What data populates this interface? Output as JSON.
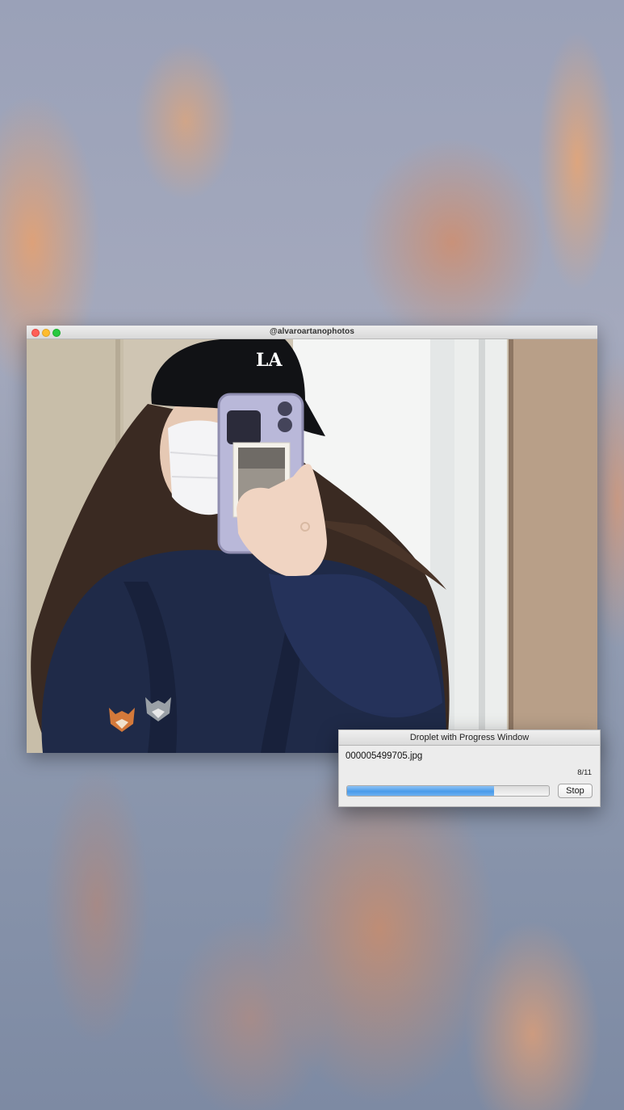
{
  "photo_window": {
    "title": "@alvaroartanophotos",
    "cap_logo": "LA"
  },
  "progress_window": {
    "title": "Droplet with Progress Window",
    "filename": "000005499705.jpg",
    "counter": "8/11",
    "progress": 0.727,
    "stop_label": "Stop"
  },
  "colors": {
    "progress_fill": "#4a9bea",
    "close": "#fe5f57",
    "minimize": "#febc2e",
    "maximize": "#28c840"
  }
}
